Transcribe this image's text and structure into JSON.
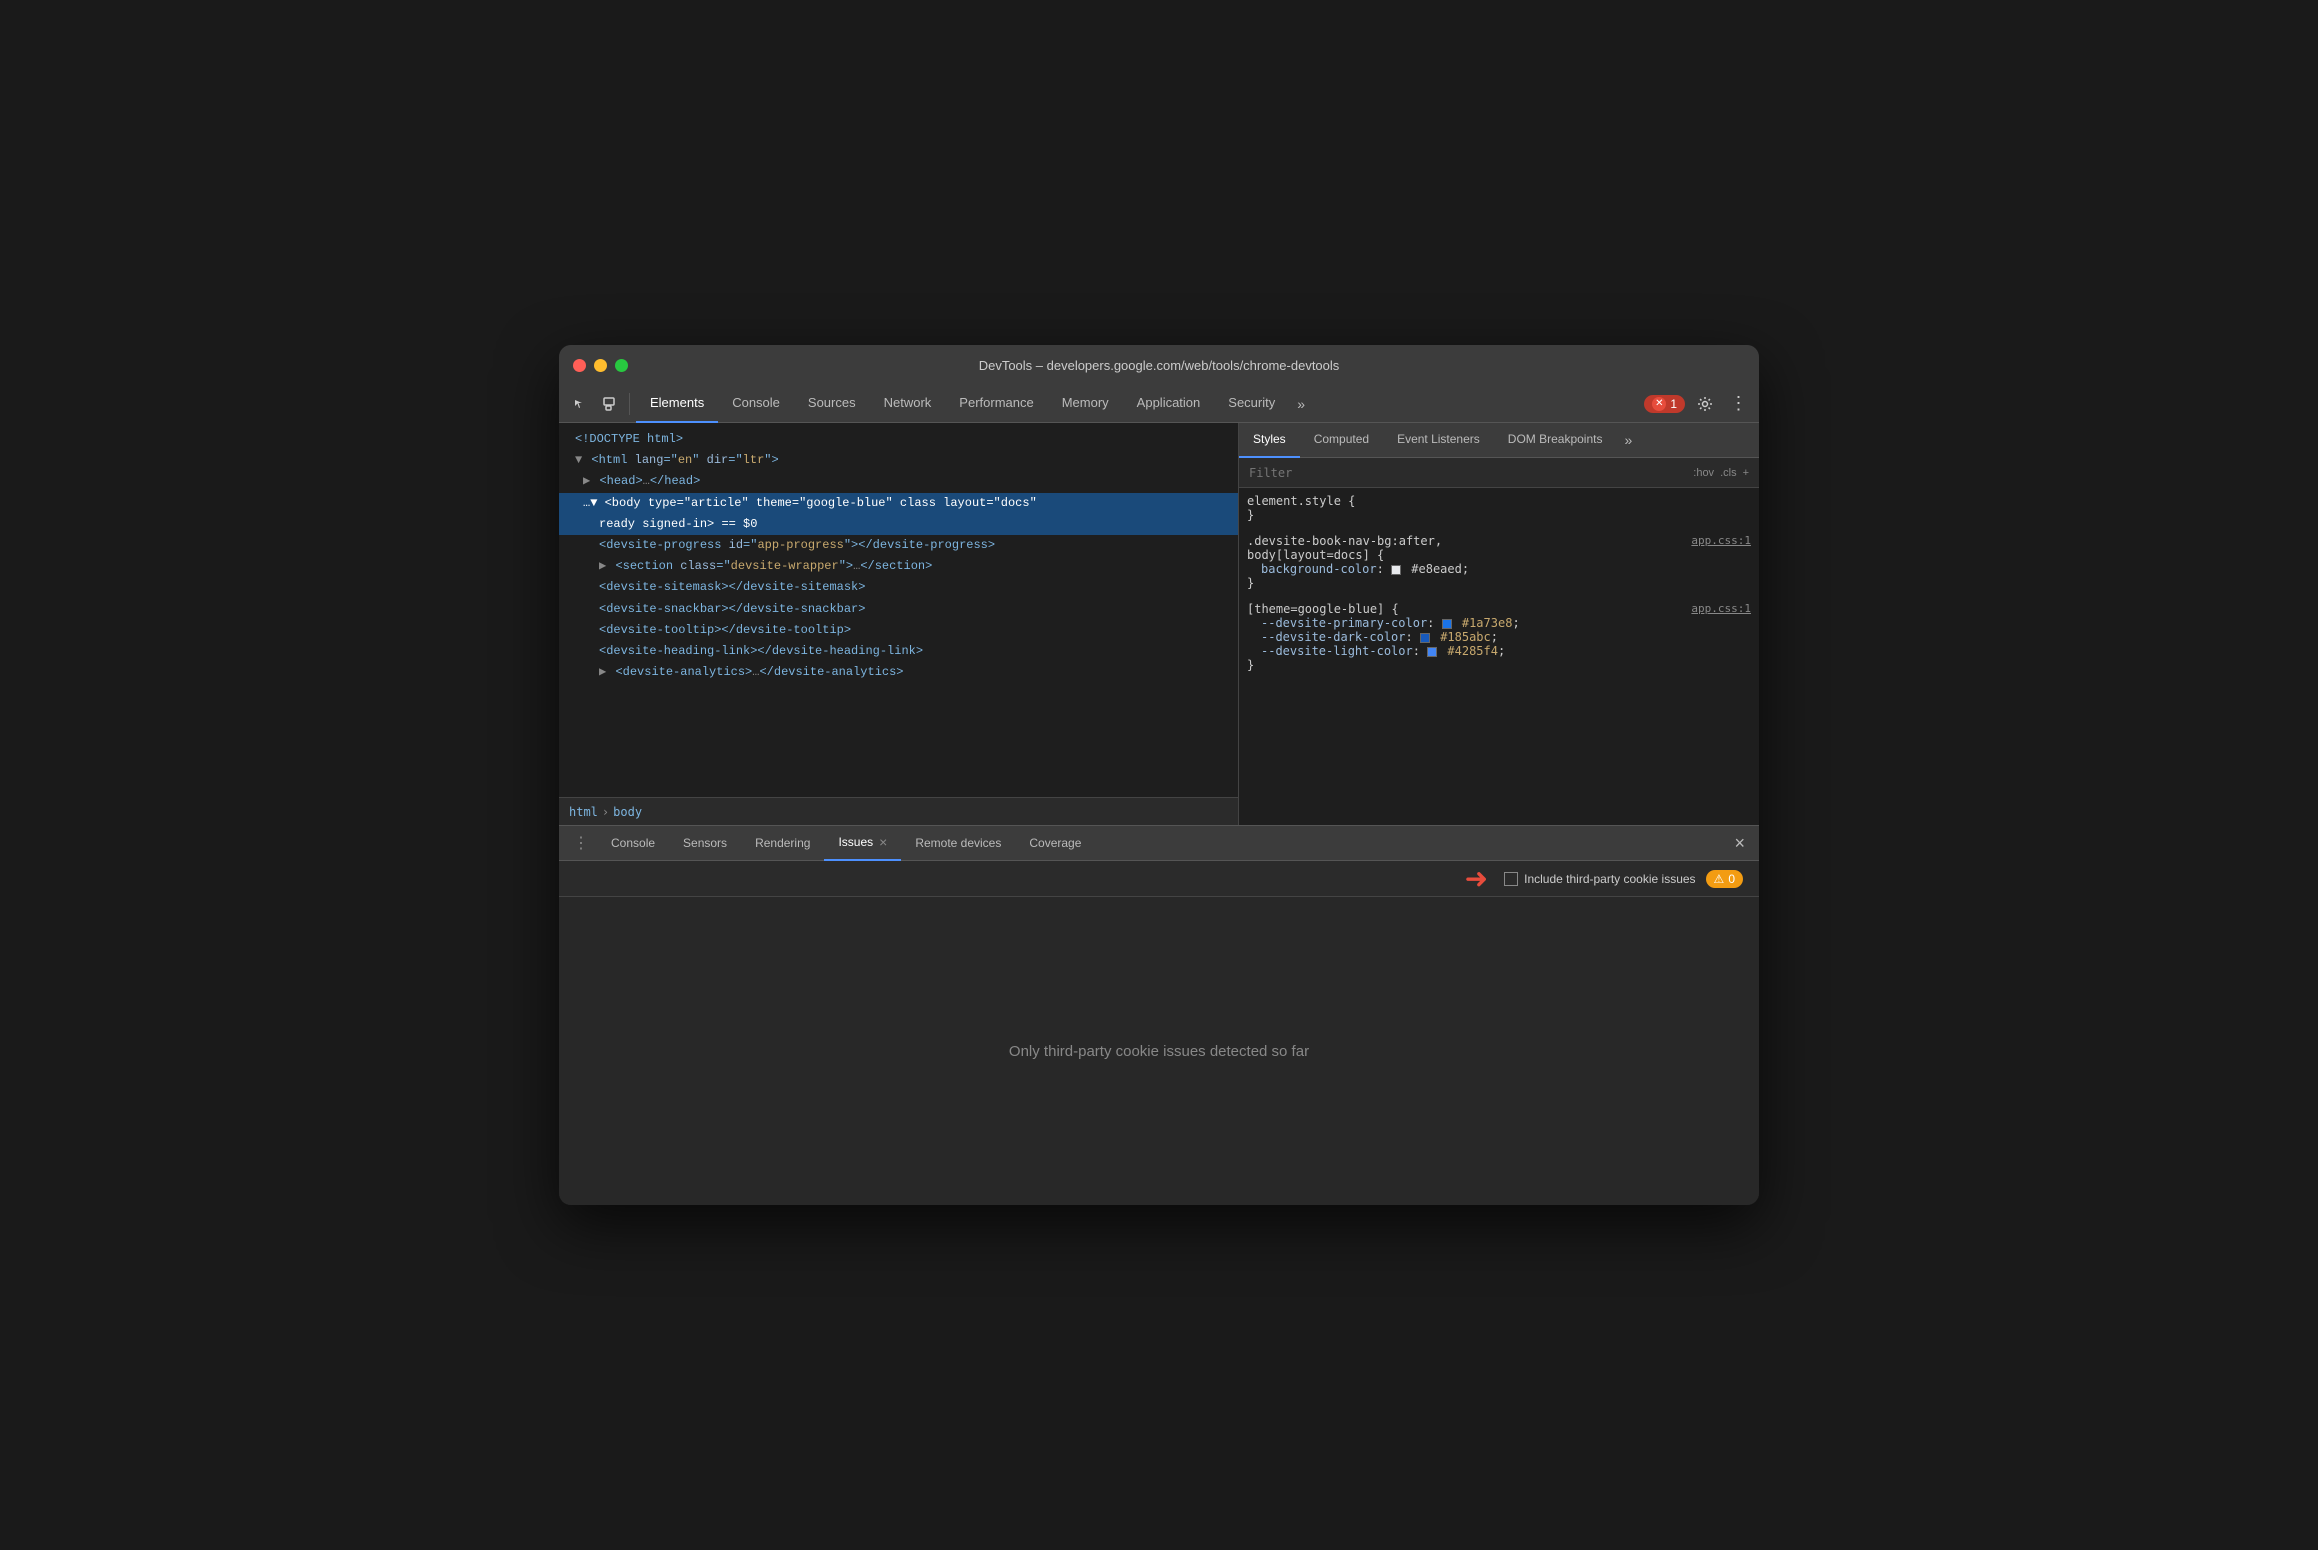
{
  "window": {
    "title": "DevTools – developers.google.com/web/tools/chrome-devtools"
  },
  "toolbar": {
    "tabs": [
      {
        "label": "Elements",
        "active": true
      },
      {
        "label": "Console",
        "active": false
      },
      {
        "label": "Sources",
        "active": false
      },
      {
        "label": "Network",
        "active": false
      },
      {
        "label": "Performance",
        "active": false
      },
      {
        "label": "Memory",
        "active": false
      },
      {
        "label": "Application",
        "active": false
      },
      {
        "label": "Security",
        "active": false
      }
    ],
    "more_label": "»",
    "error_count": "1",
    "error_x": "✕"
  },
  "dom_tree": {
    "lines": [
      {
        "text": "<!DOCTYPE html>",
        "indent": 0,
        "type": "doctype"
      },
      {
        "text": "<html lang=\"en\" dir=\"ltr\">",
        "indent": 0,
        "type": "tag"
      },
      {
        "text": "▶ <head>…</head>",
        "indent": 1,
        "type": "collapsed"
      },
      {
        "text": "<body type=\"article\" theme=\"google-blue\" class layout=\"docs\"",
        "indent": 1,
        "type": "body-open",
        "selected": true
      },
      {
        "text": "ready signed-in> == $0",
        "indent": 2,
        "type": "body-attr",
        "selected": true
      },
      {
        "text": "<devsite-progress id=\"app-progress\"></devsite-progress>",
        "indent": 2,
        "type": "element"
      },
      {
        "text": "▶ <section class=\"devsite-wrapper\">…</section>",
        "indent": 2,
        "type": "collapsed"
      },
      {
        "text": "<devsite-sitemask></devsite-sitemask>",
        "indent": 2,
        "type": "element"
      },
      {
        "text": "<devsite-snackbar></devsite-snackbar>",
        "indent": 2,
        "type": "element"
      },
      {
        "text": "<devsite-tooltip></devsite-tooltip>",
        "indent": 2,
        "type": "element"
      },
      {
        "text": "<devsite-heading-link></devsite-heading-link>",
        "indent": 2,
        "type": "element"
      },
      {
        "text": "▶ <devsite-analytics>…</devsite-analytics>",
        "indent": 2,
        "type": "collapsed"
      }
    ]
  },
  "breadcrumb": {
    "items": [
      "html",
      "body"
    ]
  },
  "styles_panel": {
    "tabs": [
      {
        "label": "Styles",
        "active": true
      },
      {
        "label": "Computed",
        "active": false
      },
      {
        "label": "Event Listeners",
        "active": false
      },
      {
        "label": "DOM Breakpoints",
        "active": false
      }
    ],
    "more_label": "»",
    "filter_placeholder": "Filter",
    "filter_hov": ":hov",
    "filter_cls": ".cls",
    "filter_plus": "+",
    "rules": [
      {
        "selector": "element.style {",
        "closing": "}",
        "properties": []
      },
      {
        "selector": ".devsite-book-nav-bg:after,",
        "selector2": "body[layout=docs] {",
        "source": "app.css:1",
        "closing": "}",
        "properties": [
          {
            "name": "background-color:",
            "value": "#e8eaed",
            "color": "#e8eaed",
            "hasColor": true
          }
        ]
      },
      {
        "selector": "[theme=google-blue] {",
        "source": "app.css:1",
        "closing": "}",
        "properties": [
          {
            "name": "--devsite-primary-color:",
            "value": "#1a73e8",
            "color": "#1a73e8",
            "hasColor": true
          },
          {
            "name": "--devsite-dark-color:",
            "value": "#185abc",
            "color": "#185abc",
            "hasColor": true
          },
          {
            "name": "--devsite-light-color:",
            "value": "#4285f4",
            "color": "#4285f4",
            "hasColor": true
          }
        ]
      }
    ]
  },
  "bottom_panel": {
    "tabs": [
      {
        "label": "Console",
        "closeable": false
      },
      {
        "label": "Sensors",
        "closeable": false
      },
      {
        "label": "Rendering",
        "closeable": false
      },
      {
        "label": "Issues",
        "closeable": true,
        "active": true
      },
      {
        "label": "Remote devices",
        "closeable": false
      },
      {
        "label": "Coverage",
        "closeable": false
      }
    ],
    "issues": {
      "checkbox_label": "Include third-party cookie issues",
      "warning_count": "0",
      "empty_message": "Only third-party cookie issues detected so far"
    }
  }
}
